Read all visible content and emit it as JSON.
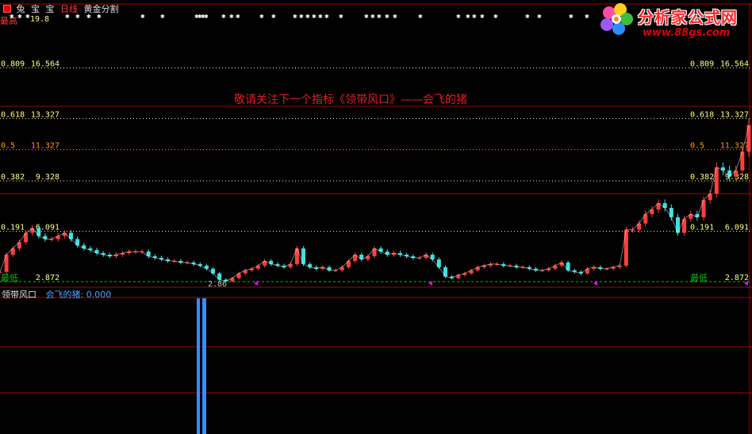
{
  "header": {
    "items": [
      "兔",
      "宝",
      "宝",
      "日线",
      "黄金分割"
    ]
  },
  "notice": "敬请关注下一个指标《领带风口》——会飞的猪",
  "logo": {
    "brand": "分析家公式网",
    "url": "www.88gs.com"
  },
  "main_panel": {
    "top_label": "最高",
    "top_value": "19.8",
    "bottom_label": "最低",
    "fib_levels": [
      {
        "ratio": "0.809",
        "price": "16.564",
        "color": "#ffff80"
      },
      {
        "ratio": "0.618",
        "price": "13.327",
        "color": "#ffff80"
      },
      {
        "ratio": "0.5",
        "price": "11.327",
        "color": "#ff9a00"
      },
      {
        "ratio": "0.382",
        "price": "9.328",
        "color": "#ffff80"
      },
      {
        "ratio": "0.191",
        "price": "6.091",
        "color": "#ffff80"
      },
      {
        "ratio": "",
        "price": "2.872",
        "color": "#ffff80"
      }
    ],
    "low_mark": "2.86",
    "colors": {
      "up": "#ff4040",
      "down": "#40e0e0",
      "low_line": "#00c000",
      "grid": "#ffff80",
      "frame": "#a00000",
      "marker": "#ff00ff"
    }
  },
  "sub_panel": {
    "name": "领带风口",
    "indicator_label": "会飞的猪:",
    "indicator_value": "0.000",
    "bar_color": "#3a8cff"
  },
  "chart_data": {
    "type": "line",
    "ylim": [
      2.872,
      19.8
    ],
    "ytick_labels": [
      "2.872",
      "6.091",
      "9.328",
      "11.327",
      "13.327",
      "16.564"
    ],
    "series": [
      {
        "values": [
          3.5,
          4.6,
          5.0,
          5.4,
          6.0,
          6.3,
          5.8,
          5.6,
          5.6,
          5.8,
          6.0,
          5.6,
          5.2,
          5.0,
          4.9,
          4.7,
          4.6,
          4.5,
          4.6,
          4.7,
          4.8,
          4.8,
          4.8,
          4.5,
          4.4,
          4.3,
          4.2,
          4.2,
          4.1,
          4.1,
          4.0,
          3.9,
          3.7,
          3.4,
          3.0,
          2.9,
          3.1,
          3.4,
          3.6,
          3.7,
          3.9,
          4.2,
          4.0,
          3.9,
          3.8,
          4.0,
          5.0,
          4.0,
          3.8,
          3.7,
          3.8,
          3.6,
          3.6,
          3.8,
          4.2,
          4.6,
          4.3,
          4.5,
          5.0,
          4.8,
          4.6,
          4.7,
          4.6,
          4.5,
          4.4,
          4.4,
          4.6,
          4.3,
          3.8,
          3.2,
          3.1,
          3.3,
          3.4,
          3.6,
          3.8,
          3.9,
          4.0,
          4.0,
          3.9,
          3.9,
          3.8,
          3.8,
          3.7,
          3.6,
          3.6,
          3.7,
          3.9,
          4.1,
          3.6,
          3.5,
          3.4,
          3.7,
          3.8,
          3.7,
          3.7,
          3.8,
          3.9,
          6.2,
          6.2,
          6.6,
          7.2,
          7.5,
          7.9,
          7.6,
          7.0,
          6.0,
          6.9,
          7.2,
          7.0,
          8.1,
          8.5,
          10.2,
          10.0,
          9.6,
          10.0,
          11.2,
          12.9
        ]
      }
    ]
  }
}
